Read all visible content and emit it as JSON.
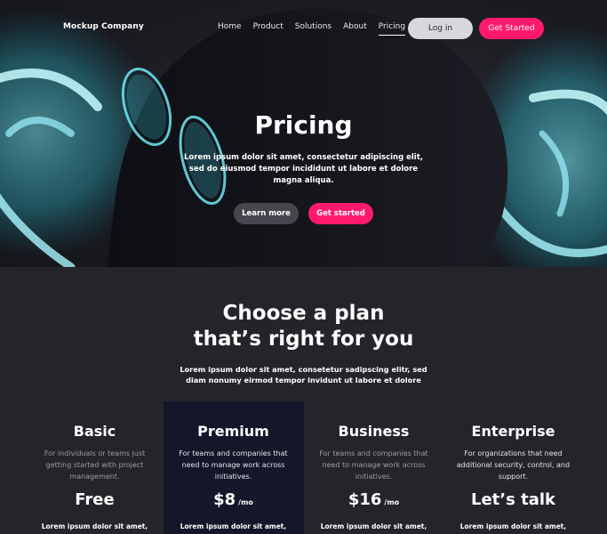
{
  "nav": {
    "logo": "Mockup Company",
    "links": [
      "Home",
      "Product",
      "Solutions",
      "About",
      "Pricing"
    ],
    "active": "Pricing",
    "login_label": "Log in",
    "get_started_label": "Get Started"
  },
  "hero": {
    "title": "Pricing",
    "subtitle": "Lorem ipsum dolor sit amet, consectetur adipiscing elit, sed do eiusmod tempor incididunt ut labore et dolore magna aliqua.",
    "learn_more_label": "Learn more",
    "get_started_label": "Get started"
  },
  "plans_section": {
    "heading_line1": "Choose a plan",
    "heading_line2": "that’s right for you",
    "subtitle": "Lorem ipsum dolor sit amet, consetetur sadipscing elitr, sed diam nonumy eirmod tempor invidunt ut labore et dolore",
    "plans": [
      {
        "name": "Basic",
        "description": "For individuals or teams just getting started with project management.",
        "price": "Free",
        "per": "",
        "feature": "Lorem ipsum dolor sit amet,"
      },
      {
        "name": "Premium",
        "description": "For teams and companies that need to manage work across initiatives.",
        "price": "$8",
        "per": "/mo",
        "feature": "Lorem ipsum dolor sit amet,"
      },
      {
        "name": "Business",
        "description": "For teams and companies that need to manage work across initiatives.",
        "price": "$16",
        "per": "/mo",
        "feature": "Lorem ipsum dolor sit amet,"
      },
      {
        "name": "Enterprise",
        "description": "For organizations that need additional security, control, and support.",
        "price": "Let’s talk",
        "per": "",
        "feature": "Lorem ipsum dolor sit amet,"
      }
    ]
  },
  "colors": {
    "accent": "#ff1a6c",
    "background": "#24252b",
    "premium_highlight": "#141729",
    "neon": "#3de3f0"
  }
}
